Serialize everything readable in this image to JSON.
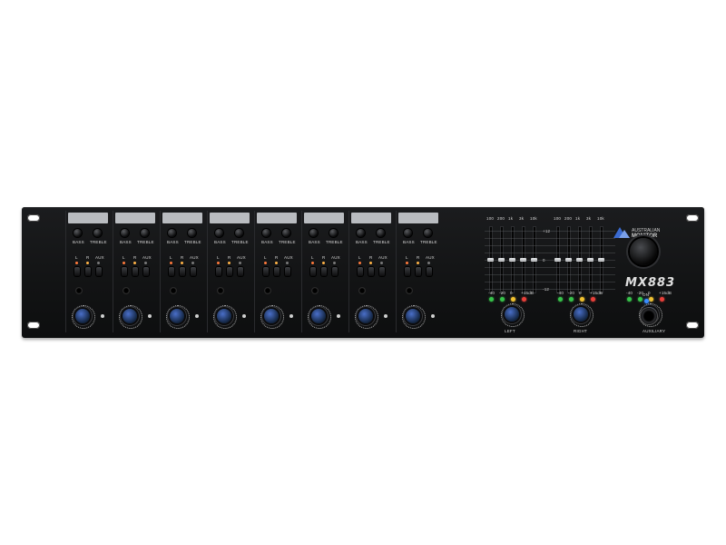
{
  "device": {
    "brand": "AUSTRALIAN MONITOR",
    "model": "MX883",
    "colors": {
      "panel": "#121314",
      "knob_accent": "#4a6fc9",
      "power_led": "#3a8dff"
    }
  },
  "channels": [
    {
      "bass": "BASS",
      "treble": "TREBLE",
      "l": "L",
      "r": "R",
      "aux": "AUX"
    },
    {
      "bass": "BASS",
      "treble": "TREBLE",
      "l": "L",
      "r": "R",
      "aux": "AUX"
    },
    {
      "bass": "BASS",
      "treble": "TREBLE",
      "l": "L",
      "r": "R",
      "aux": "AUX"
    },
    {
      "bass": "BASS",
      "treble": "TREBLE",
      "l": "L",
      "r": "R",
      "aux": "AUX"
    },
    {
      "bass": "BASS",
      "treble": "TREBLE",
      "l": "L",
      "r": "R",
      "aux": "AUX"
    },
    {
      "bass": "BASS",
      "treble": "TREBLE",
      "l": "L",
      "r": "R",
      "aux": "AUX"
    },
    {
      "bass": "BASS",
      "treble": "TREBLE",
      "l": "L",
      "r": "R",
      "aux": "AUX"
    },
    {
      "bass": "BASS",
      "treble": "TREBLE",
      "l": "L",
      "r": "R",
      "aux": "AUX"
    }
  ],
  "eq": {
    "bands": [
      "100",
      "200",
      "1k",
      "3k",
      "10k"
    ],
    "scale": [
      "+12",
      "0",
      "-12"
    ]
  },
  "meters": [
    {
      "label": "LEFT",
      "leds": [
        "-40",
        "-20",
        "0",
        "+15dB"
      ]
    },
    {
      "label": "RIGHT",
      "leds": [
        "-40",
        "-20",
        "0",
        "+15dB"
      ]
    },
    {
      "label": "AUXILIARY",
      "leds": [
        "-40",
        "-20",
        "0",
        "+15dB"
      ]
    }
  ],
  "power": {
    "label": "ON"
  }
}
